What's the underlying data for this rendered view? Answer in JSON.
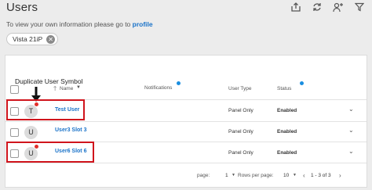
{
  "header": {
    "title": "Users",
    "icons": [
      "share-icon",
      "refresh-icon",
      "add-user-icon",
      "filter-icon"
    ]
  },
  "info": {
    "text": "To view your own information please go to",
    "link": "profile"
  },
  "filter_chip": {
    "label": "Vista 21iP"
  },
  "annotation": {
    "label": "Duplicate User Symbol",
    "color": "#d0141c"
  },
  "table": {
    "columns": {
      "name": "Name",
      "notifications": "Notifications",
      "user_type": "User Type",
      "status": "Status"
    },
    "rows": [
      {
        "initial": "T",
        "name": "Test User",
        "user_type": "Panel Only",
        "status": "Enabled",
        "duplicate": true
      },
      {
        "initial": "U",
        "name": "User3 Slot 3",
        "user_type": "Panel Only",
        "status": "Enabled",
        "duplicate": false
      },
      {
        "initial": "U",
        "name": "User6 Slot 6",
        "user_type": "Panel Only",
        "status": "Enabled",
        "duplicate": true
      }
    ]
  },
  "pagination": {
    "page_label": "page:",
    "page_value": "1",
    "rows_label": "Rows per page:",
    "rows_value": "10",
    "range": "1 - 3 of 3"
  }
}
